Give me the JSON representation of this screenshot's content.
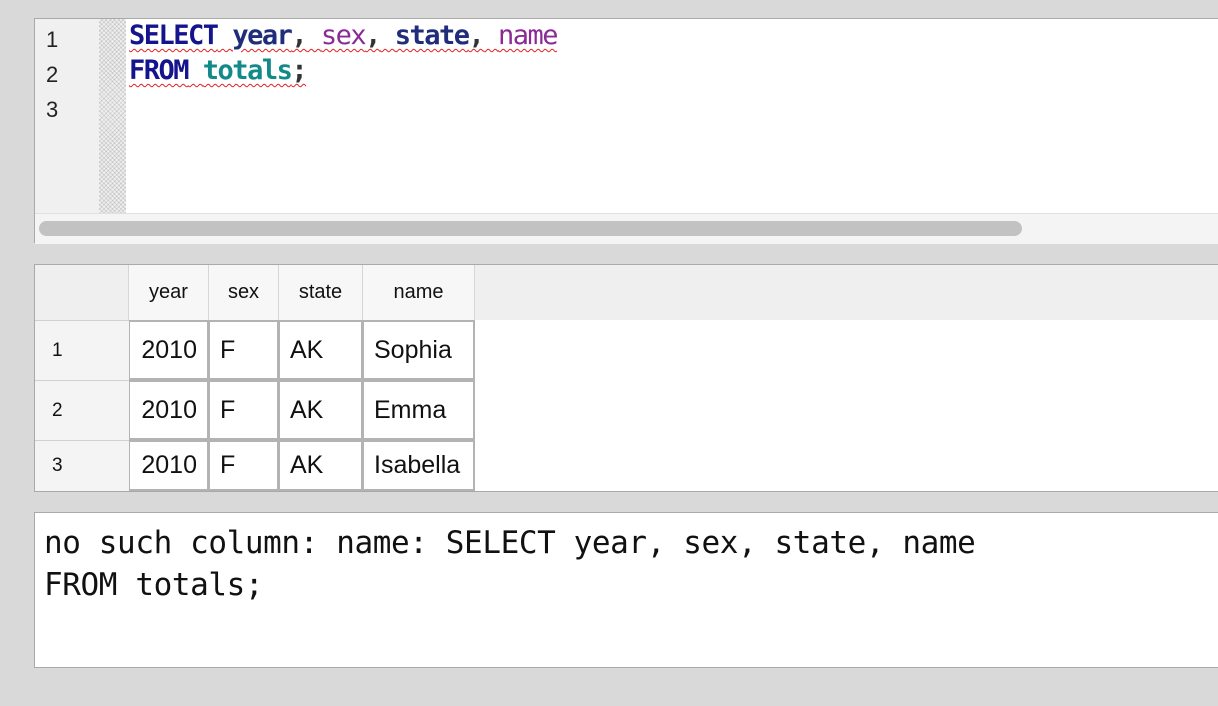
{
  "editor": {
    "line_numbers": [
      "1",
      "2",
      "3"
    ],
    "line1": {
      "kw_select": "SELECT",
      "id_year": "year",
      "comma1": ",",
      "id_sex": "sex",
      "comma2": ",",
      "id_state": "state",
      "comma3": ",",
      "id_name": "name"
    },
    "line2": {
      "kw_from": "FROM",
      "id_totals": "totals",
      "semicolon": ";"
    }
  },
  "results": {
    "columns": [
      "year",
      "sex",
      "state",
      "name"
    ],
    "rows": [
      {
        "index": "1",
        "year": "2010",
        "sex": "F",
        "state": "AK",
        "name": "Sophia"
      },
      {
        "index": "2",
        "year": "2010",
        "sex": "F",
        "state": "AK",
        "name": "Emma"
      },
      {
        "index": "3",
        "year": "2010",
        "sex": "F",
        "state": "AK",
        "name": "Isabella"
      }
    ]
  },
  "message": {
    "line1": "no such column: name: SELECT year, sex, state, name",
    "line2": "FROM totals;"
  },
  "colors": {
    "keyword": "#14148c",
    "identifier_purple": "#8a2a96",
    "identifier_teal": "#138a8a",
    "error_squiggle": "#e02020"
  }
}
